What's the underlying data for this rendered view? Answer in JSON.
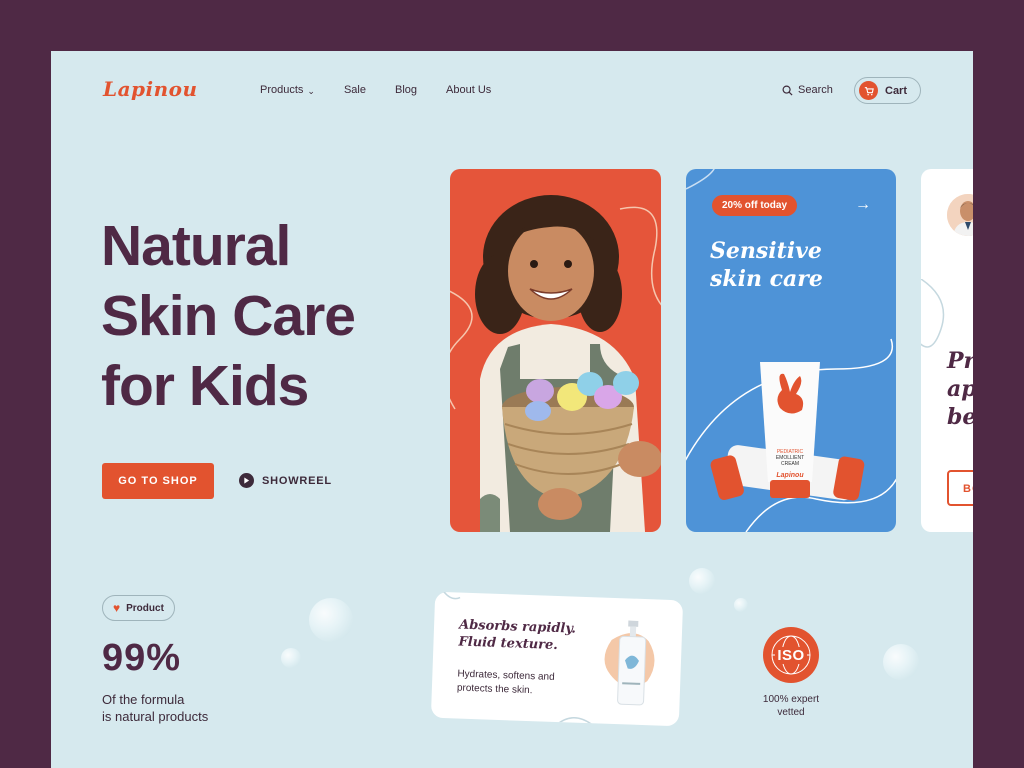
{
  "brand": {
    "logo": "Lapinou",
    "accent": "#e2532f",
    "dark": "#4f2945",
    "bg": "#d6e9ee"
  },
  "nav": {
    "items": [
      {
        "label": "Products",
        "has_dropdown": true
      },
      {
        "label": "Sale"
      },
      {
        "label": "Blog"
      },
      {
        "label": "About Us"
      }
    ],
    "search_label": "Search",
    "cart_label": "Cart"
  },
  "hero": {
    "title_line1": "Natural",
    "title_line2": "Skin Care",
    "title_line3": "for Kids",
    "shop_button": "GO TO SHOP",
    "showreel_label": "SHOWREEL"
  },
  "cards": {
    "promo": {
      "discount": "20% off today",
      "title_line1": "Sensitive",
      "title_line2": "skin care",
      "tube_brand": "Lapinou",
      "tube_line1": "PEDIATRIC",
      "tube_line2": "EMOLLIENT CREAM"
    },
    "partial": {
      "text_line1": "Pr",
      "text_line2": "ap",
      "text_line3": "be",
      "button": "BO"
    }
  },
  "stats": {
    "badge": "Product",
    "value": "99%",
    "desc_line1": "Of the formula",
    "desc_line2": "is natural products"
  },
  "feature_card": {
    "title_line1": "Absorbs rapidly.",
    "title_line2": "Fluid texture.",
    "desc_line1": "Hydrates, softens and",
    "desc_line2": "protects the skin."
  },
  "certification": {
    "badge": "ISO",
    "desc_line1": "100% expert",
    "desc_line2": "vetted"
  }
}
